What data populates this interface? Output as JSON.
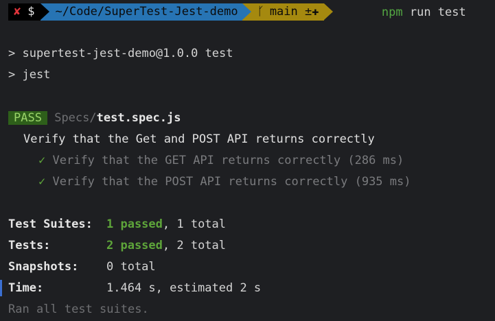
{
  "prompt": {
    "status_x": "✘",
    "status_dollar": "$",
    "directory": "~/Code/SuperTest-Jest-demo",
    "branch_icon": "ᚴ",
    "branch": "main ±✚",
    "command_program": "npm",
    "command_args": "run test"
  },
  "output": {
    "script_line": "> supertest-jest-demo@1.0.0 test",
    "jest_line": "> jest",
    "pass_badge": "PASS",
    "spec_dir": "Specs/",
    "spec_file": "test.spec.js",
    "describe": "Verify that the Get and POST API returns correctly",
    "tests": [
      {
        "check": "✓",
        "name": "Verify that the GET API returns correctly (286 ms)"
      },
      {
        "check": "✓",
        "name": "Verify that the POST API returns correctly (935 ms)"
      }
    ],
    "summary": {
      "suites_label": "Test Suites:",
      "suites_passed": "1 passed",
      "suites_total": ", 1 total",
      "tests_label": "Tests:",
      "tests_passed": "2 passed",
      "tests_total": ", 2 total",
      "snapshots_label": "Snapshots:",
      "snapshots_value": "0 total",
      "time_label": "Time:",
      "time_value": "1.464 s, estimated 2 s"
    },
    "ran_all": "Ran all test suites."
  },
  "colors": {
    "background": "#1e1f22",
    "dir_segment": "#2774b4",
    "git_segment": "#a5890f",
    "pass_green": "#5ea53a",
    "error_red": "#e0343b"
  }
}
